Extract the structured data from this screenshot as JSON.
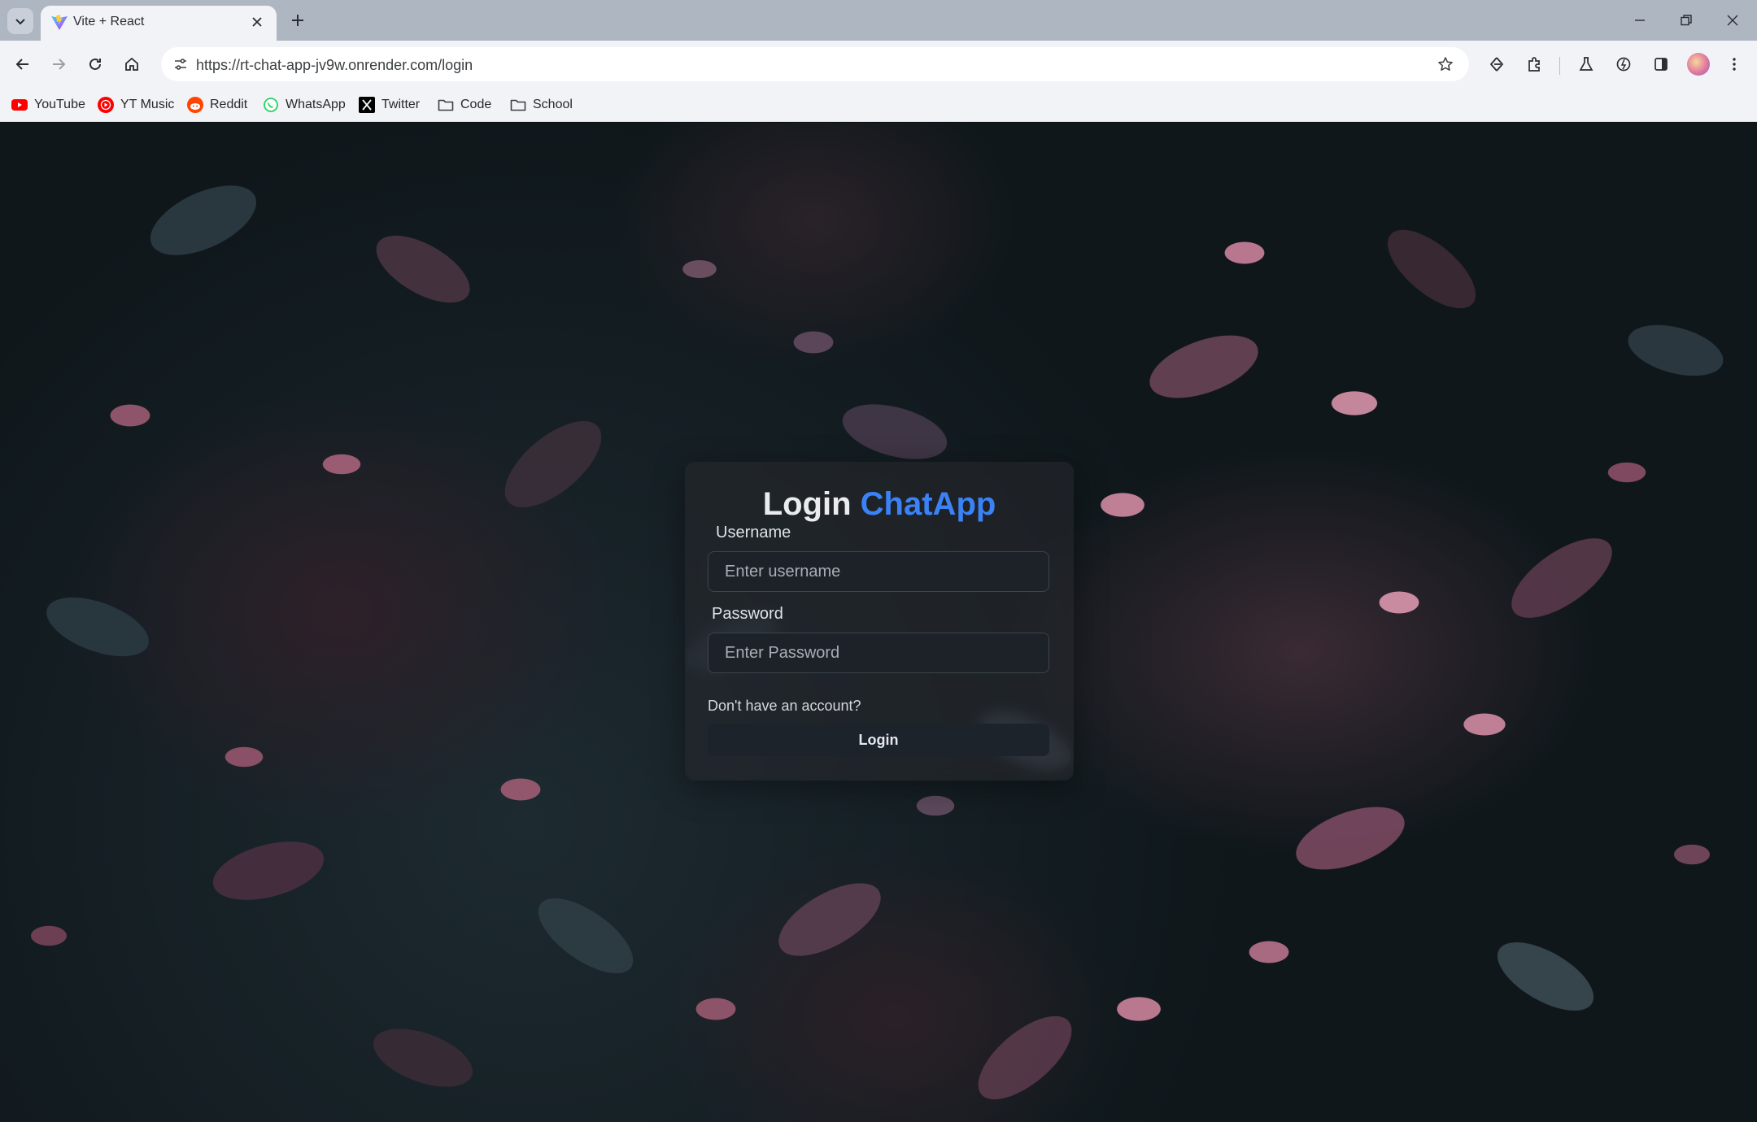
{
  "browser": {
    "tab_title": "Vite + React",
    "url": "https://rt-chat-app-jv9w.onrender.com/login",
    "bookmarks": [
      {
        "label": "YouTube",
        "icon": "youtube-icon"
      },
      {
        "label": "YT Music",
        "icon": "yt-music-icon"
      },
      {
        "label": "Reddit",
        "icon": "reddit-icon"
      },
      {
        "label": "WhatsApp",
        "icon": "whatsapp-icon"
      },
      {
        "label": "Twitter",
        "icon": "x-twitter-icon"
      },
      {
        "label": "Code",
        "icon": "folder-icon"
      },
      {
        "label": "School",
        "icon": "folder-icon"
      }
    ]
  },
  "login": {
    "title_main": "Login",
    "title_accent": "ChatApp",
    "accent_color": "#3b82f6",
    "username_label": "Username",
    "username_placeholder": "Enter username",
    "password_label": "Password",
    "password_placeholder": "Enter Password",
    "signup_link": "Don't have an account?",
    "submit_label": "Login"
  }
}
